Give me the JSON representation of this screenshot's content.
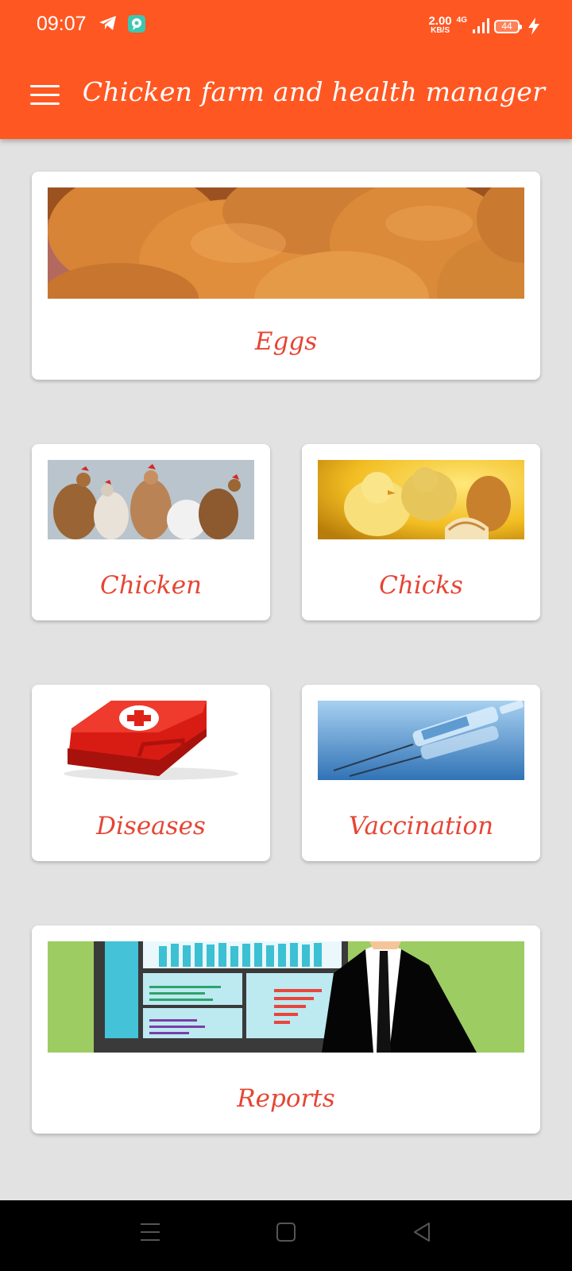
{
  "status_bar": {
    "time": "09:07",
    "icons": [
      "telegram-icon",
      "chat-bubble-icon"
    ],
    "net_speed_value": "2.00",
    "net_speed_unit": "KB/S",
    "network": "4G",
    "battery": "44"
  },
  "app_bar": {
    "title": "Chicken farm and health manager",
    "menu_icon": "hamburger-menu-icon"
  },
  "cards": {
    "eggs": {
      "label": "Eggs",
      "image": "eggs-photo"
    },
    "chicken": {
      "label": "Chicken",
      "image": "hens-photo"
    },
    "chicks": {
      "label": "Chicks",
      "image": "chicks-photo"
    },
    "diseases": {
      "label": "Diseases",
      "image": "first-aid-kit-photo"
    },
    "vaccination": {
      "label": "Vaccination",
      "image": "syringe-photo"
    },
    "reports": {
      "label": "Reports",
      "image": "reports-dashboard-illustration"
    }
  },
  "colors": {
    "primary": "#ff5722",
    "label": "#e64534",
    "background": "#e3e2e3"
  },
  "nav_bar": {
    "icons": [
      "recents-icon",
      "home-icon",
      "back-icon"
    ]
  }
}
